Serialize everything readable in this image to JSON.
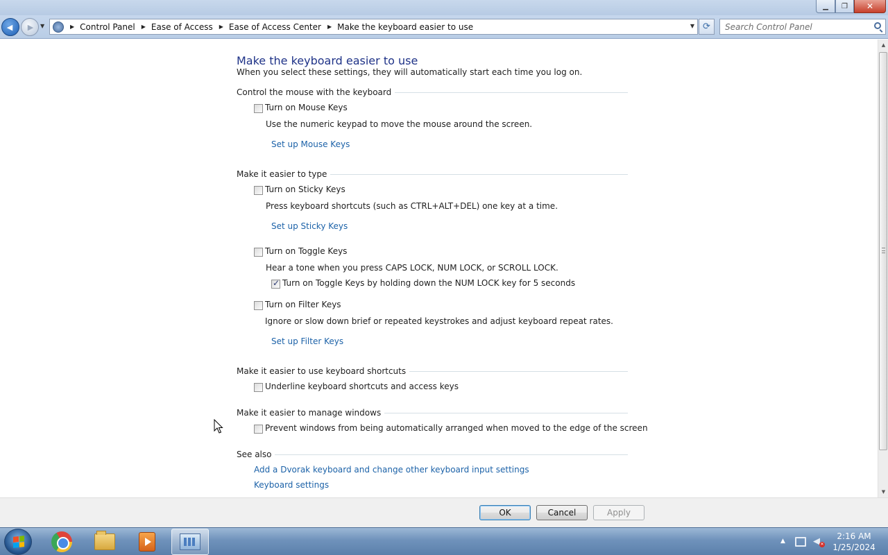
{
  "window": {
    "minimize_glyph": "▁",
    "maximize_glyph": "❐",
    "close_glyph": "✕"
  },
  "nav": {
    "back_glyph": "◀",
    "forward_glyph": "▶",
    "breadcrumb": [
      "Control Panel",
      "Ease of Access",
      "Ease of Access Center",
      "Make the keyboard easier to use"
    ],
    "search_placeholder": "Search Control Panel"
  },
  "page": {
    "title": "Make the keyboard easier to use",
    "subtitle": "When you select these settings, they will automatically start each time you log on."
  },
  "sections": {
    "mouse": {
      "header": "Control the mouse with the keyboard",
      "mouse_keys_label": "Turn on Mouse Keys",
      "mouse_keys_checked": false,
      "mouse_keys_desc": "Use the numeric keypad to move the mouse around the screen.",
      "mouse_keys_link": "Set up Mouse Keys"
    },
    "typing": {
      "header": "Make it easier to type",
      "sticky_label": "Turn on Sticky Keys",
      "sticky_checked": false,
      "sticky_desc": "Press keyboard shortcuts (such as CTRL+ALT+DEL) one key at a time.",
      "sticky_link": "Set up Sticky Keys",
      "toggle_label": "Turn on Toggle Keys",
      "toggle_checked": false,
      "toggle_desc": "Hear a tone when you press CAPS LOCK, NUM LOCK, or SCROLL LOCK.",
      "toggle_hold_label": "Turn on Toggle Keys by holding down the NUM LOCK key for 5 seconds",
      "toggle_hold_checked": true,
      "filter_label": "Turn on Filter Keys",
      "filter_checked": false,
      "filter_desc": "Ignore or slow down brief or repeated keystrokes and adjust keyboard repeat rates.",
      "filter_link": "Set up Filter Keys"
    },
    "shortcuts": {
      "header": "Make it easier to use keyboard shortcuts",
      "underline_label": "Underline keyboard shortcuts and access keys",
      "underline_checked": false
    },
    "windows": {
      "header": "Make it easier to manage windows",
      "prevent_label": "Prevent windows from being automatically arranged when moved to the edge of the screen",
      "prevent_checked": false
    },
    "see_also": {
      "header": "See also",
      "links": [
        "Add a Dvorak keyboard and change other keyboard input settings",
        "Keyboard settings"
      ]
    }
  },
  "buttons": {
    "ok": "OK",
    "cancel": "Cancel",
    "apply": "Apply"
  },
  "taskbar": {
    "time": "2:16 AM",
    "date": "1/25/2024",
    "apps": [
      "chrome-icon",
      "file-explorer-icon",
      "media-player-icon",
      "control-panel-icon"
    ]
  },
  "colors": {
    "link": "#1c62a8",
    "title": "#1e3287"
  }
}
